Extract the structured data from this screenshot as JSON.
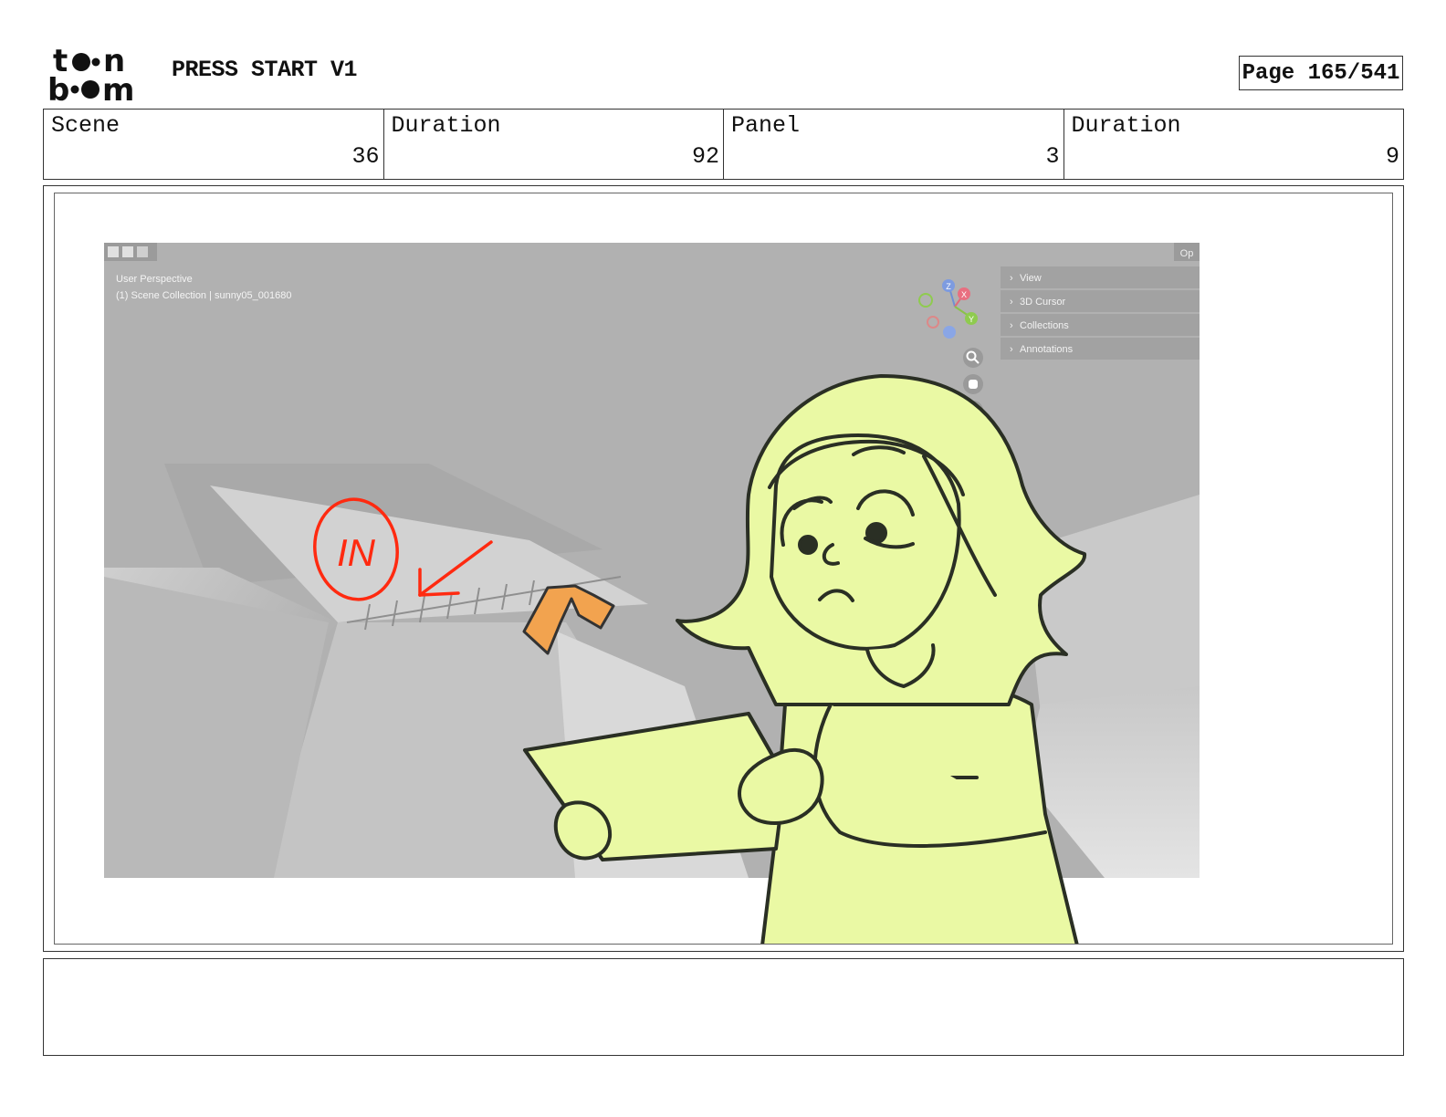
{
  "header": {
    "logo_text": "toon boom",
    "project_title": "PRESS START V1",
    "page_label": "Page 165/541"
  },
  "info": {
    "scene_label": "Scene",
    "scene_value": "36",
    "scene_duration_label": "Duration",
    "scene_duration_value": "92",
    "panel_label": "Panel",
    "panel_value": "3",
    "panel_duration_label": "Duration",
    "panel_duration_value": "9"
  },
  "viewport": {
    "perspective_label": "User Perspective",
    "collection_label": "(1) Scene Collection | sunny05_001680",
    "corner_button": "Op",
    "side_menu": [
      "View",
      "3D Cursor",
      "Collections",
      "Annotations"
    ],
    "gizmo_axes": [
      "Z",
      "X",
      "Y"
    ]
  },
  "annotation": {
    "mark_text": "IN"
  },
  "colors": {
    "character_fill": "#eaf9a4",
    "annotation_red": "#ff2a10",
    "accent_orange": "#f5a24a",
    "viewport_gray": "#b3b3b3"
  },
  "notes": ""
}
